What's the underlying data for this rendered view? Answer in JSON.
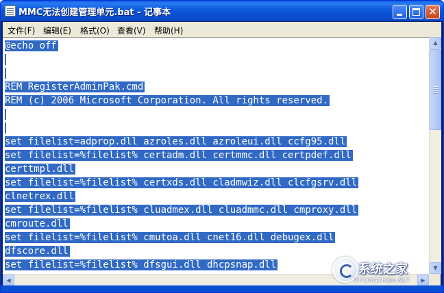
{
  "window": {
    "title": "MMC无法创建管理单元.bat - 记事本",
    "icon": "notepad-icon"
  },
  "title_buttons": {
    "close_glyph": "✕"
  },
  "menu": {
    "items": [
      {
        "label": "文件(F)"
      },
      {
        "label": "编辑(E)"
      },
      {
        "label": "格式(O)"
      },
      {
        "label": "查看(V)"
      },
      {
        "label": "帮助(H)"
      }
    ]
  },
  "editor": {
    "lines": [
      "@echo off",
      "",
      "",
      "REM RegisterAdminPak.cmd",
      "REM (c) 2006 Microsoft Corporation. All rights reserved.",
      "",
      "",
      "set filelist=adprop.dll azroles.dll azroleui.dll ccfg95.dll",
      "set filelist=%filelist% certadm.dll certmmc.dll certpdef.dll",
      "certtmpl.dll",
      "set filelist=%filelist% certxds.dll cladmwiz.dll clcfgsrv.dll",
      "clnetrex.dll",
      "set filelist=%filelist% cluadmex.dll cluadmmc.dll cmproxy.dll",
      "cmroute.dll",
      "set filelist=%filelist% cmutoa.dll cnet16.dll debugex.dll",
      "dfscore.dll",
      "set filelist=%filelist% dfsgui.dll dhcpsnap.dll"
    ],
    "selection_color": "#316ac5"
  },
  "scrollbar": {
    "up_arrow": "▲",
    "down_arrow": "▼",
    "left_arrow": "◀",
    "right_arrow": "▶"
  },
  "watermark": {
    "title": "系统之家",
    "subtitle": "XITONGZHIJIA.NET"
  },
  "colors": {
    "titlebar": "#0a5be0",
    "menubar": "#ece9d8",
    "selection": "#316ac5"
  }
}
